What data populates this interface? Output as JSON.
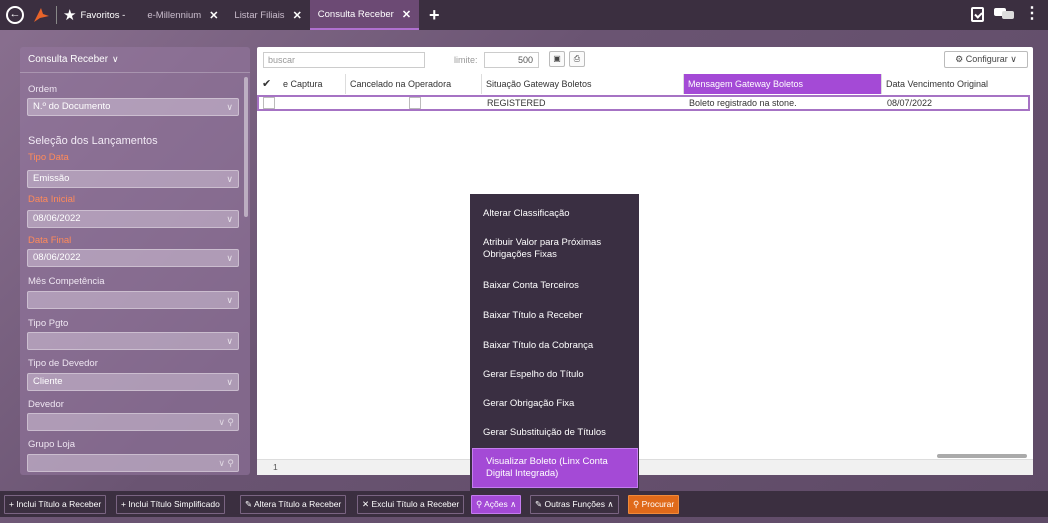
{
  "topbar": {
    "favoritos_label": "Favoritos -",
    "tabs": [
      {
        "label": "e-Millennium",
        "close": "✕"
      },
      {
        "label": "Listar Filiais",
        "close": "✕"
      },
      {
        "label": "Consulta Receber",
        "close": "✕"
      }
    ]
  },
  "left_panel": {
    "header": "Consulta Receber",
    "ordem_label": "Ordem",
    "ordem_value": "N.º do Documento",
    "section_title": "Seleção dos Lançamentos",
    "tipo_data_label": "Tipo Data",
    "tipo_data_value": "Emissão",
    "data_inicial_label": "Data Inicial",
    "data_inicial_value": "08/06/2022",
    "data_final_label": "Data Final",
    "data_final_value": "08/06/2022",
    "mes_competencia_label": "Mês Competência",
    "mes_competencia_value": "",
    "tipo_pgto_label": "Tipo Pgto",
    "tipo_pgto_value": "",
    "tipo_devedor_label": "Tipo de Devedor",
    "tipo_devedor_value": "Cliente",
    "devedor_label": "Devedor",
    "devedor_value": "",
    "grupo_loja_label": "Grupo Loja",
    "grupo_loja_value": ""
  },
  "grid": {
    "search_placeholder": "buscar",
    "limite_label": "limite:",
    "limite_value": "500",
    "configurar_label": "⚙ Configurar ∨",
    "columns": [
      "✔",
      "e Captura",
      "Cancelado na Operadora",
      "Situação Gateway Boletos",
      "Mensagem Gateway Boletos",
      "Data Vencimento Original"
    ],
    "rows": [
      {
        "situacao": "REGISTERED",
        "mensagem": "Boleto registrado na stone.",
        "vencimento": "08/07/2022"
      }
    ],
    "footer_count": "1"
  },
  "actions_menu": {
    "items": [
      "Alterar Classificação",
      "Atribuir Valor para Próximas Obrigações Fixas",
      "Baixar Conta Terceiros",
      "Baixar Título a Receber",
      "Baixar Título da Cobrança",
      "Gerar Espelho do Título",
      "Gerar Obrigação Fixa",
      "Gerar Substituição de Títulos",
      "Visualizar Boleto (Linx Conta Digital Integrada)"
    ]
  },
  "bottombar": {
    "inclui_titulo": "+ Inclui Título a Receber",
    "inclui_simplificado": "+ Inclui Título Simplificado",
    "altera_titulo": "Altera Título a Receber",
    "exclui_titulo": "✕ Exclui Título a Receber",
    "acoes": "Ações ∧",
    "outras_funcoes": "Outras Funções ∧",
    "procurar": "Procurar"
  },
  "colors": {
    "accent": "#a44ad6",
    "topbar": "#3b2f40",
    "procurar": "#e06a1a"
  }
}
